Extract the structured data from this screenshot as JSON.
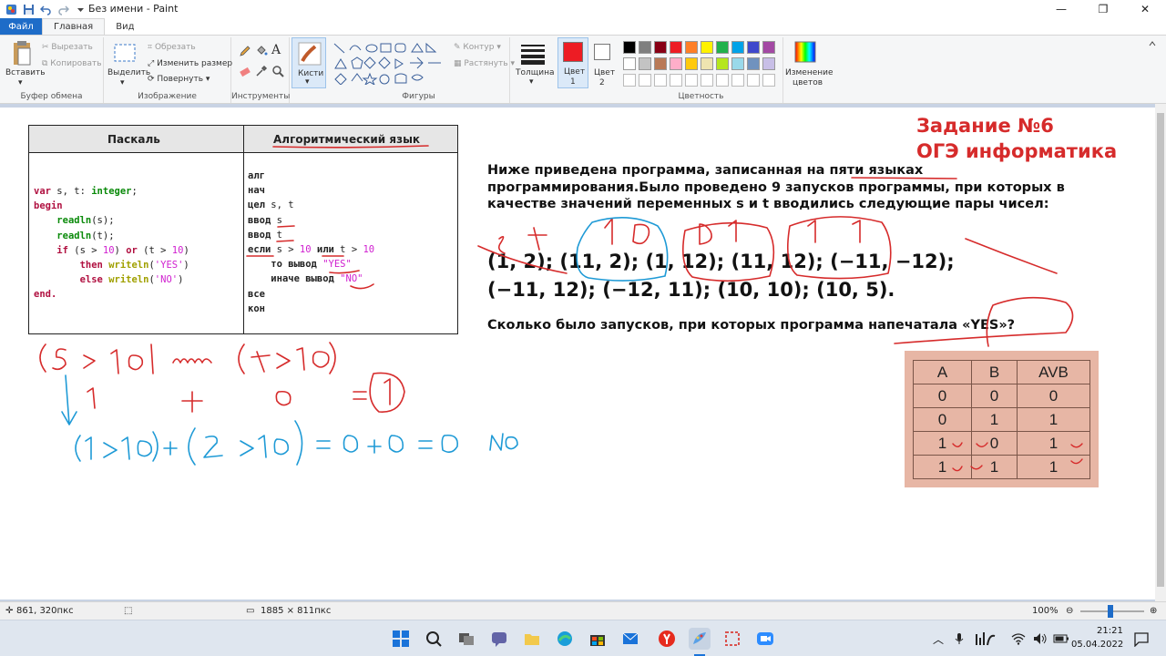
{
  "window": {
    "title": "Без имени - Paint",
    "minimize": "—",
    "maximize": "❐",
    "close": "✕"
  },
  "tabs": [
    {
      "label": "Файл"
    },
    {
      "label": "Главная"
    },
    {
      "label": "Вид"
    }
  ],
  "ribbon": {
    "clipboard": {
      "paste": "Вставить",
      "cut": "Вырезать",
      "copy": "Копировать",
      "label": "Буфер обмена"
    },
    "image": {
      "select": "Выделить",
      "crop": "Обрезать",
      "resize": "Изменить размер",
      "rotate": "Повернуть",
      "label": "Изображение"
    },
    "tools": {
      "label": "Инструменты"
    },
    "brushes": {
      "label": "Кисти"
    },
    "shapes": {
      "outline": "Контур",
      "fill": "Растянуть",
      "label": "Фигуры"
    },
    "size": {
      "label": "Толщина"
    },
    "color1": {
      "label": "Цвет",
      "num": "1",
      "value": "#ed1c24"
    },
    "color2": {
      "label": "Цвет",
      "num": "2",
      "value": "#ffffff"
    },
    "colors": {
      "label": "Цветность",
      "row1": [
        "#000000",
        "#7f7f7f",
        "#880015",
        "#ed1c24",
        "#ff7f27",
        "#fff200",
        "#22b14c",
        "#00a2e8",
        "#3f48cc",
        "#a349a4"
      ],
      "row2": [
        "#ffffff",
        "#c3c3c3",
        "#b97a57",
        "#ffaec9",
        "#ffc90e",
        "#efe4b0",
        "#b5e61d",
        "#99d9ea",
        "#7092be",
        "#c8bfe7"
      ]
    },
    "edit_colors": {
      "line1": "Изменение",
      "line2": "цветов"
    }
  },
  "content": {
    "table": {
      "col1": "Паскаль",
      "col2": "Алгоритмический язык"
    },
    "pascal": {
      "l1a": "var",
      "l1b": " s, t: ",
      "l1c": "integer",
      "l1d": ";",
      "l2": "begin",
      "l3a": "readln",
      "l3b": "(s);",
      "l4a": "readln",
      "l4b": "(t);",
      "l5a": "if",
      "l5b": " (s > ",
      "l5c": "10",
      "l5d": ") ",
      "l5e": "or",
      "l5f": " (t > ",
      "l5g": "10",
      "l5h": ")",
      "l6a": "then",
      "l6b": " ",
      "l6c": "writeln",
      "l6d": "(",
      "l6e": "'YES'",
      "l6f": ")",
      "l7a": "else",
      "l7b": " ",
      "l7c": "writeln",
      "l7d": "(",
      "l7e": "'NO'",
      "l7f": ")",
      "l8": "end."
    },
    "algo": {
      "l1": "алг",
      "l2": "нач",
      "l3a": "цел",
      "l3b": " s, t",
      "l4a": "ввод",
      "l4b": " s",
      "l5a": "ввод",
      "l5b": " t",
      "l6a": "если",
      "l6b": " s > ",
      "l6c": "10",
      "l6d": " ",
      "l6e": "или",
      "l6f": " t > ",
      "l6g": "10",
      "l7a": "то вывод",
      "l7b": " ",
      "l7c": "\"YES\"",
      "l8a": "иначе вывод",
      "l8b": " ",
      "l8c": "\"NO\"",
      "l9": "все",
      "l10": "кон"
    },
    "task_title_1": "Задание №6",
    "task_title_2": "ОГЭ информатика",
    "task_text": "Ниже приведена программа, записанная на пяти языках программирования.Было проведено 9 запусков программы, при которых в качестве значений переменных s и t вводились следующие пары чисел:",
    "pairs_line1": "(1, 2); (11, 2); (1, 12); (11, 12); (−11, −12);",
    "pairs_line2": "(−11, 12); (−12, 11); (10, 10); (10, 5).",
    "question": "Сколько было запусков, при которых программа напечатала «YES»?",
    "truth_table": {
      "headers": [
        "A",
        "B",
        "AVB"
      ],
      "rows": [
        [
          "0",
          "0",
          "0"
        ],
        [
          "0",
          "1",
          "1"
        ],
        [
          "1",
          "0",
          "1"
        ],
        [
          "1",
          "1",
          "1"
        ]
      ]
    }
  },
  "status": {
    "cursor": "861, 320пкс",
    "size": "1885 × 811пкс",
    "zoom": "100%"
  },
  "taskbar": {
    "time": "21:21",
    "date": "05.04.2022"
  }
}
